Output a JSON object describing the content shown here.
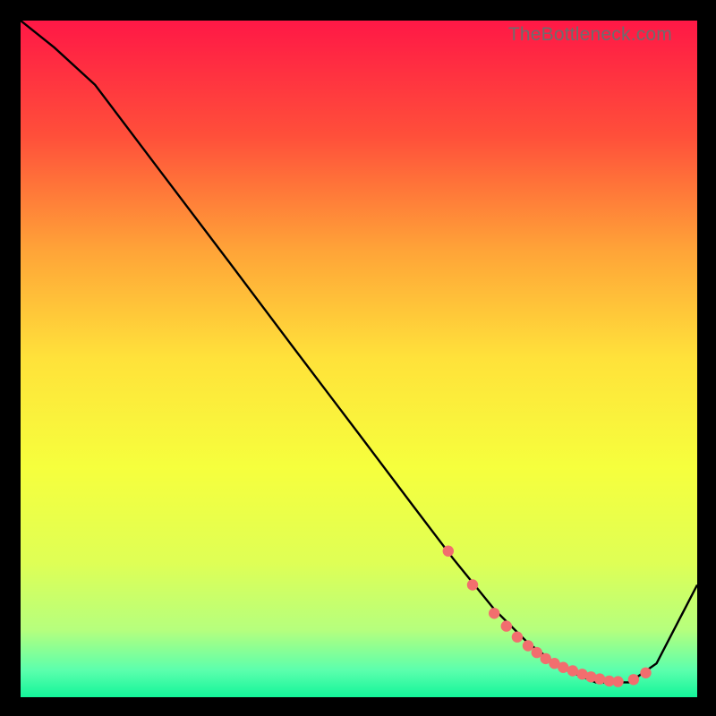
{
  "watermark": "TheBottleneck.com",
  "chart_data": {
    "type": "line",
    "title": "",
    "xlabel": "",
    "ylabel": "",
    "xlim": [
      0,
      100
    ],
    "ylim": [
      0,
      100
    ],
    "grid": false,
    "background": "heatmap-gradient-vertical",
    "gradient_stops": [
      {
        "offset": 0.0,
        "color": "#ff1846"
      },
      {
        "offset": 0.17,
        "color": "#ff4f3a"
      },
      {
        "offset": 0.34,
        "color": "#ffa438"
      },
      {
        "offset": 0.5,
        "color": "#ffe23a"
      },
      {
        "offset": 0.66,
        "color": "#f6ff3d"
      },
      {
        "offset": 0.8,
        "color": "#dfff55"
      },
      {
        "offset": 0.9,
        "color": "#b6ff7d"
      },
      {
        "offset": 0.96,
        "color": "#5cffad"
      },
      {
        "offset": 1.0,
        "color": "#13f59a"
      }
    ],
    "series": [
      {
        "name": "curve",
        "color": "#000000",
        "x": [
          0,
          5,
          11,
          20,
          30,
          40,
          50,
          58,
          64,
          70,
          75,
          80,
          85,
          90,
          94,
          100
        ],
        "y": [
          100,
          96,
          90.5,
          78.6,
          65.4,
          52.1,
          38.9,
          28.3,
          20.4,
          13.0,
          8.0,
          4.3,
          2.2,
          2.2,
          5.0,
          16.6
        ]
      }
    ],
    "markers": {
      "name": "bottom-cluster",
      "color": "#f26e6e",
      "x": [
        63.2,
        66.8,
        70.0,
        71.8,
        73.4,
        75.0,
        76.3,
        77.6,
        78.9,
        80.2,
        81.6,
        83.0,
        84.3,
        85.6,
        87.0,
        88.3,
        90.6,
        92.4
      ],
      "y": [
        21.6,
        16.6,
        12.4,
        10.5,
        8.9,
        7.6,
        6.6,
        5.7,
        5.0,
        4.4,
        3.9,
        3.4,
        3.0,
        2.7,
        2.4,
        2.3,
        2.6,
        3.6
      ]
    }
  }
}
